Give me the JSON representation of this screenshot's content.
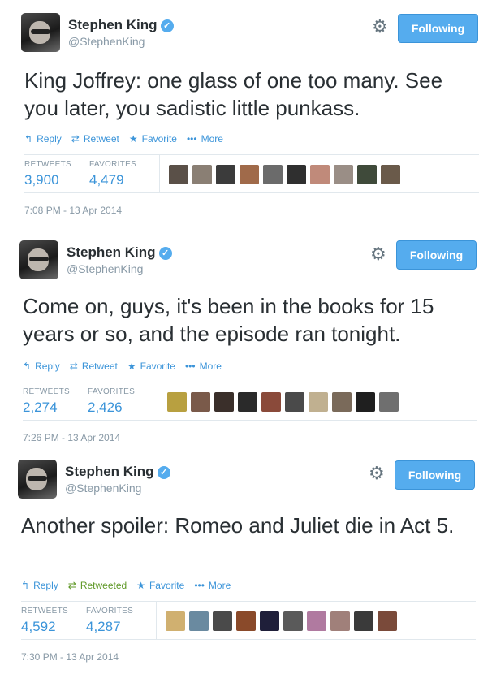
{
  "tweets": [
    {
      "name": "Stephen King",
      "handle": "@StephenKing",
      "follow_label": "Following",
      "text": "King Joffrey: one glass of one too many. See you later, you sadistic little punkass.",
      "actions": {
        "reply": "Reply",
        "retweet": "Retweet",
        "favorite": "Favorite",
        "more": "More"
      },
      "retweets_label": "RETWEETS",
      "retweets": "3,900",
      "favorites_label": "FAVORITES",
      "favorites": "4,479",
      "timestamp": "7:08 PM - 13 Apr 2014",
      "face_colors": [
        "#5a5048",
        "#8a7f74",
        "#3b3b3b",
        "#a06a4a",
        "#6b6b6b",
        "#2f2f2f",
        "#c08a7a",
        "#9a8e86",
        "#3f4a3a",
        "#6a5a4a"
      ]
    },
    {
      "name": "Stephen King",
      "handle": "@StephenKing",
      "follow_label": "Following",
      "text": "Come on, guys, it's been in the books for 15 years or so, and the episode ran tonight.",
      "actions": {
        "reply": "Reply",
        "retweet": "Retweet",
        "favorite": "Favorite",
        "more": "More"
      },
      "retweets_label": "RETWEETS",
      "retweets": "2,274",
      "favorites_label": "FAVORITES",
      "favorites": "2,426",
      "timestamp": "7:26 PM - 13 Apr 2014",
      "face_colors": [
        "#b8a040",
        "#7a5a4a",
        "#3a2f2a",
        "#2a2a2a",
        "#8a4a3a",
        "#4a4a4a",
        "#c0b090",
        "#7a6a5a",
        "#1f1f1f",
        "#6f6f6f"
      ]
    },
    {
      "name": "Stephen King",
      "handle": "@StephenKing",
      "follow_label": "Following",
      "text": "Another spoiler: Romeo and Juliet die in Act 5.",
      "actions": {
        "reply": "Reply",
        "retweet": "Retweeted",
        "favorite": "Favorite",
        "more": "More"
      },
      "retweets_label": "RETWEETS",
      "retweets": "4,592",
      "favorites_label": "FAVORITES",
      "favorites": "4,287",
      "timestamp": "7:30 PM - 13 Apr 2014",
      "face_colors": [
        "#d0b070",
        "#6a8aa0",
        "#4a4a4a",
        "#8a4a2a",
        "#1f1f3a",
        "#5a5a5a",
        "#b07aa0",
        "#a0807a",
        "#3a3a3a",
        "#7a4a3a"
      ]
    }
  ],
  "icons": {
    "reply": "reply-icon",
    "retweet": "retweet-icon",
    "favorite": "star-icon",
    "more": "more-dots-icon",
    "settings": "gear-icon",
    "verified": "verified-badge-icon"
  },
  "colors": {
    "accent": "#55acee",
    "link": "#3b94d9",
    "retweeted": "#609928",
    "muted": "#8899a6"
  }
}
